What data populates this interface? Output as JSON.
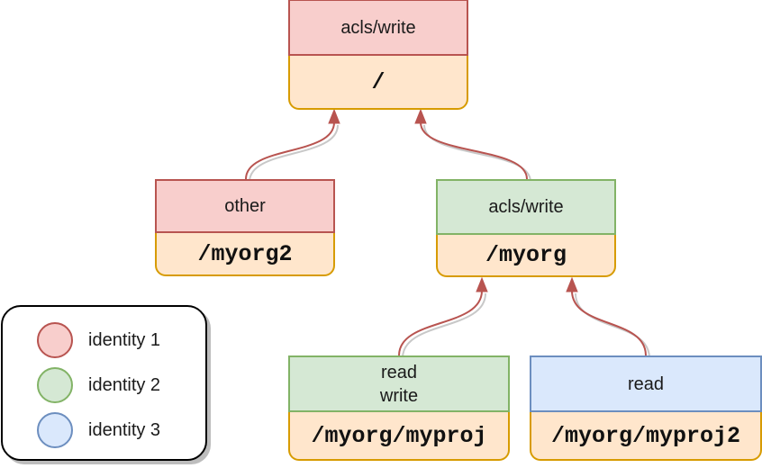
{
  "diagram": {
    "colors": {
      "identity_1": {
        "fill": "#f8cecc",
        "stroke": "#b85450"
      },
      "identity_2": {
        "fill": "#d5e8d4",
        "stroke": "#82b366"
      },
      "identity_3": {
        "fill": "#dae8fc",
        "stroke": "#6c8ebf"
      },
      "path_fill": "#ffe6cc",
      "path_stroke": "#d79b00",
      "edge": "#b85450",
      "edge_shadow": "#c8c8c8"
    },
    "nodes": {
      "root": {
        "permission_lines": [
          "acls/write"
        ],
        "path": "/",
        "identity": "identity_1"
      },
      "myorg2": {
        "permission_lines": [
          "other"
        ],
        "path": "/myorg2",
        "identity": "identity_1"
      },
      "myorg": {
        "permission_lines": [
          "acls/write"
        ],
        "path": "/myorg",
        "identity": "identity_2"
      },
      "myproj": {
        "permission_lines": [
          "read",
          "write"
        ],
        "path": "/myorg/myproj",
        "identity": "identity_2"
      },
      "myproj2": {
        "permission_lines": [
          "read"
        ],
        "path": "/myorg/myproj2",
        "identity": "identity_3"
      }
    },
    "edges": [
      {
        "from": "myorg2",
        "to": "root"
      },
      {
        "from": "myorg",
        "to": "root"
      },
      {
        "from": "myproj",
        "to": "myorg"
      },
      {
        "from": "myproj2",
        "to": "myorg"
      }
    ]
  },
  "legend": {
    "items": [
      {
        "label": "identity 1",
        "identity": "identity_1"
      },
      {
        "label": "identity 2",
        "identity": "identity_2"
      },
      {
        "label": "identity 3",
        "identity": "identity_3"
      }
    ]
  }
}
